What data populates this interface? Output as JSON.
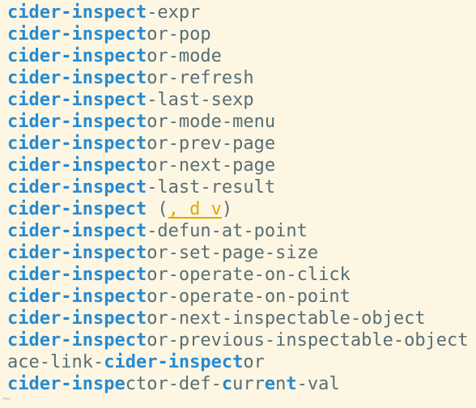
{
  "completion_list": {
    "items": [
      {
        "parts": [
          {
            "t": "cider-inspect",
            "m": true
          },
          {
            "t": "-expr",
            "m": false
          }
        ]
      },
      {
        "parts": [
          {
            "t": "cider-inspect",
            "m": true
          },
          {
            "t": "or-pop",
            "m": false
          }
        ]
      },
      {
        "parts": [
          {
            "t": "cider-inspect",
            "m": true
          },
          {
            "t": "or-mode",
            "m": false
          }
        ]
      },
      {
        "parts": [
          {
            "t": "cider-inspect",
            "m": true
          },
          {
            "t": "or-refresh",
            "m": false
          }
        ]
      },
      {
        "parts": [
          {
            "t": "cider-inspect",
            "m": true
          },
          {
            "t": "-last-sexp",
            "m": false
          }
        ]
      },
      {
        "parts": [
          {
            "t": "cider-inspect",
            "m": true
          },
          {
            "t": "or-mode-menu",
            "m": false
          }
        ]
      },
      {
        "parts": [
          {
            "t": "cider-inspect",
            "m": true
          },
          {
            "t": "or-prev-page",
            "m": false
          }
        ]
      },
      {
        "parts": [
          {
            "t": "cider-inspect",
            "m": true
          },
          {
            "t": "or-next-page",
            "m": false
          }
        ]
      },
      {
        "parts": [
          {
            "t": "cider-inspect",
            "m": true
          },
          {
            "t": "-last-result",
            "m": false
          }
        ]
      },
      {
        "parts": [
          {
            "t": "cider-inspect",
            "m": true
          },
          {
            "t": " (",
            "m": false
          },
          {
            "t": ", d v",
            "kb": true
          },
          {
            "t": ")",
            "m": false
          }
        ]
      },
      {
        "parts": [
          {
            "t": "cider-inspect",
            "m": true
          },
          {
            "t": "-defun-at-point",
            "m": false
          }
        ]
      },
      {
        "parts": [
          {
            "t": "cider-inspect",
            "m": true
          },
          {
            "t": "or-set-page-size",
            "m": false
          }
        ]
      },
      {
        "parts": [
          {
            "t": "cider-inspect",
            "m": true
          },
          {
            "t": "or-operate-on-click",
            "m": false
          }
        ]
      },
      {
        "parts": [
          {
            "t": "cider-inspect",
            "m": true
          },
          {
            "t": "or-operate-on-point",
            "m": false
          }
        ]
      },
      {
        "parts": [
          {
            "t": "cider-inspect",
            "m": true
          },
          {
            "t": "or-next-inspectable-object",
            "m": false
          }
        ]
      },
      {
        "parts": [
          {
            "t": "cider-inspect",
            "m": true
          },
          {
            "t": "or-previous-inspectable-object",
            "m": false
          }
        ]
      },
      {
        "parts": [
          {
            "t": "ace-link-",
            "m": false
          },
          {
            "t": "cider-inspect",
            "m": true
          },
          {
            "t": "or",
            "m": false
          }
        ]
      },
      {
        "parts": [
          {
            "t": "cider-inspe",
            "m": true
          },
          {
            "t": "ctor-def-",
            "m": false
          },
          {
            "t": "c",
            "m": true
          },
          {
            "t": "urr",
            "m": false
          },
          {
            "t": "e",
            "m": true
          },
          {
            "t": "n",
            "m": false
          },
          {
            "t": "t",
            "m": true
          },
          {
            "t": "-val",
            "m": false
          }
        ]
      }
    ]
  },
  "fringe": {
    "tilde": "~"
  },
  "colors": {
    "background": "#fdf6e3",
    "match": "#268bd2",
    "text": "#586e75",
    "keybinding": "#e0a800"
  }
}
